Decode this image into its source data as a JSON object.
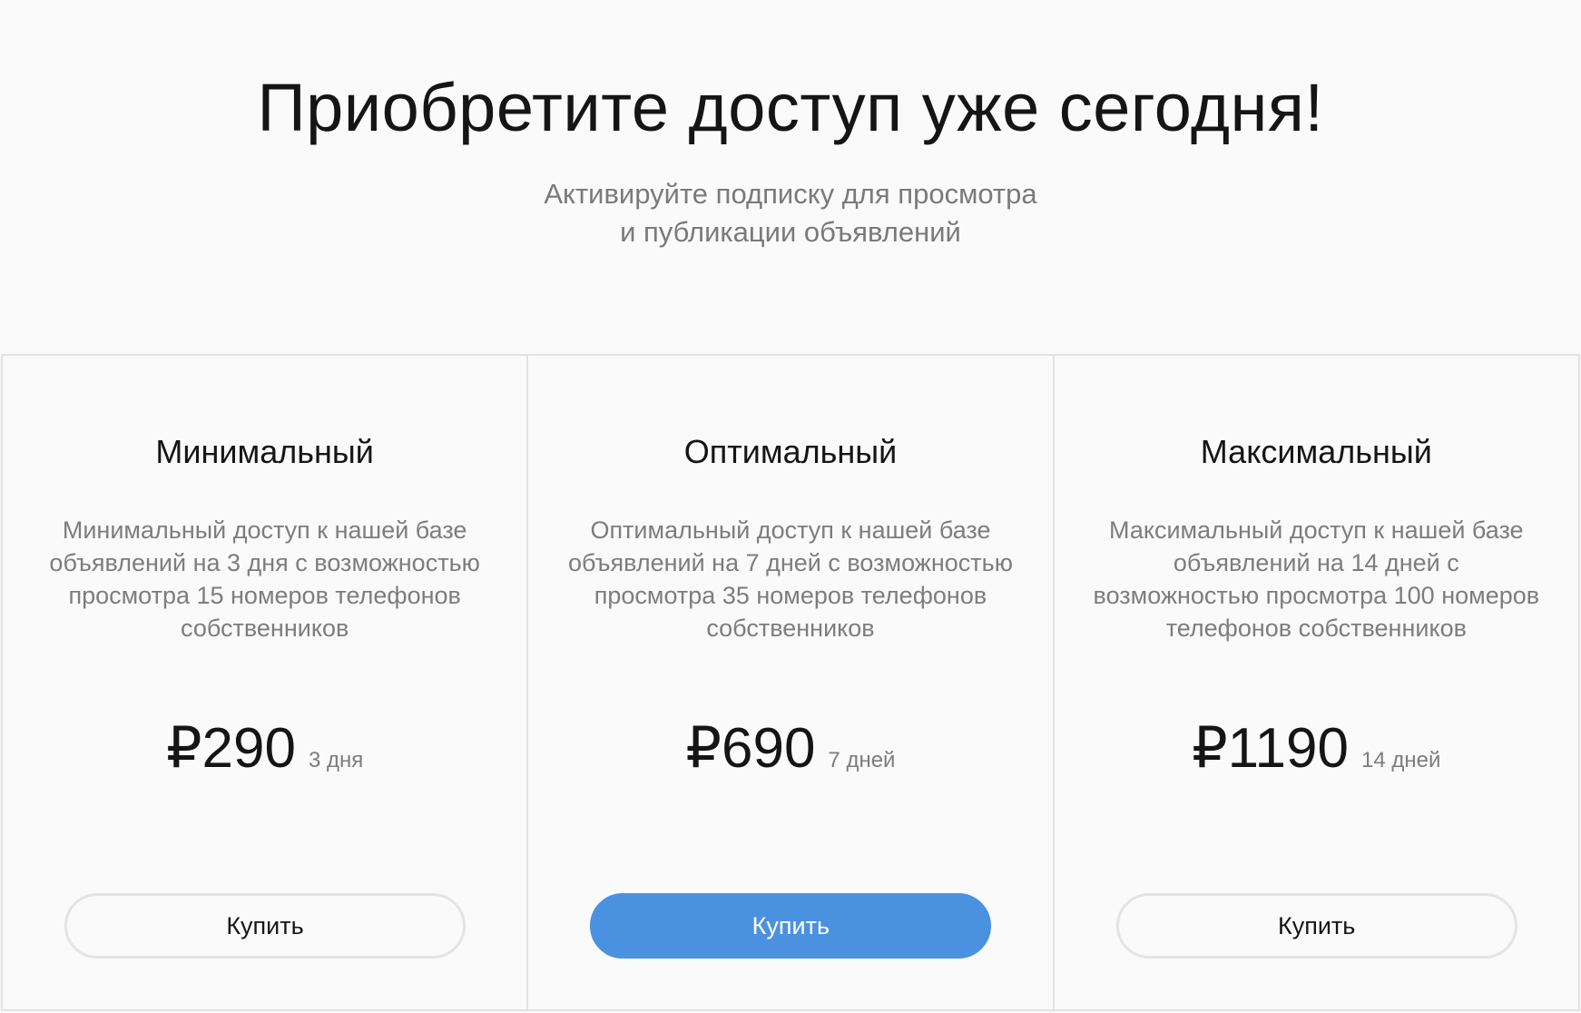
{
  "hero": {
    "title": "Приобретите доступ уже сегодня!",
    "subtitle": "Активируйте подписку для просмотра\nи публикации объявлений"
  },
  "plans": [
    {
      "name": "Минимальный",
      "description": "Минимальный доступ к нашей базе объявлений на 3 дня с возможностью просмотра 15 номеров телефонов собственников",
      "price": "₽290",
      "period": "3 дня",
      "button_label": "Купить",
      "highlighted": false
    },
    {
      "name": "Оптимальный",
      "description": "Оптимальный доступ к нашей базе объявлений на 7 дней с возможностью просмотра 35 номеров телефонов собственников",
      "price": "₽690",
      "period": "7 дней",
      "button_label": "Купить",
      "highlighted": true
    },
    {
      "name": "Максимальный",
      "description": "Максимальный доступ к нашей базе объявлений на 14 дней с возможностью просмотра 100 номеров телефонов собственников",
      "price": "₽1190",
      "period": "14 дней",
      "button_label": "Купить",
      "highlighted": false
    }
  ],
  "colors": {
    "accent": "#4a92e0",
    "background": "#fafafa",
    "border": "#e2e2e2",
    "muted_text": "#7d7d7d"
  }
}
